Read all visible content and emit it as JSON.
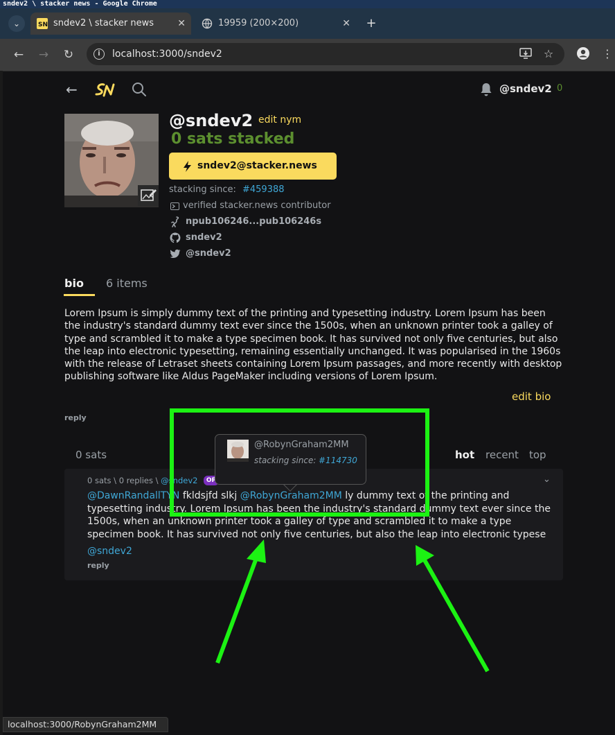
{
  "os": {
    "window_title": "sndev2 \\ stacker news - Google Chrome"
  },
  "browser": {
    "tabs": [
      {
        "label": "sndev2 \\ stacker news",
        "active": true
      },
      {
        "label": "19959 (200×200)",
        "active": false
      }
    ],
    "url": "localhost:3000/sndev2",
    "status_url": "localhost:3000/RobynGraham2MM"
  },
  "header": {
    "me_name": "@sndev2",
    "me_sats": "0"
  },
  "profile": {
    "nym": "@sndev2",
    "edit_nym": "edit nym",
    "sats_stacked": "0 sats stacked",
    "ln_address": "sndev2@stacker.news",
    "stacking_since_label": "stacking since:",
    "stacking_since_link": "#459388",
    "verified": "verified stacker.news contributor",
    "nostr": "npub106246...pub106246s",
    "github": "sndev2",
    "twitter": "@sndev2"
  },
  "tabs": {
    "bio": "bio",
    "items": "6 items"
  },
  "bio": {
    "text": "Lorem Ipsum is simply dummy text of the printing and typesetting industry. Lorem Ipsum has been the industry's standard dummy text ever since the 1500s, when an unknown printer took a galley of type and scrambled it to make a type specimen book. It has survived not only five centuries, but also the leap into electronic typesetting, remaining essentially unchanged. It was popularised in the 1960s with the release of Letraset sheets containing Lorem Ipsum passages, and more recently with desktop publishing software like Aldus PageMaker including versions of Lorem Ipsum.",
    "edit": "edit bio",
    "reply": "reply"
  },
  "comments_header": {
    "sats": "0 sats",
    "sort": [
      "hot",
      "recent",
      "top"
    ]
  },
  "comment": {
    "meta": "0 sats \\ 0 replies \\ ",
    "author": "@sndev2",
    "op_badge": "OP",
    "collapse": "⌄",
    "mention1": "@DawnRandallTYN",
    "text1": " fkldsjfd slkj ",
    "mention2": "@RobynGraham2MM",
    "text2": " ly dummy text of the printing and typesetting industry. Lorem Ipsum has been the industry's standard dummy text ever since the 1500s, when an unknown printer took a galley of type and scrambled it to make a type specimen book. It has survived not only five centuries, but also the leap into electronic typese",
    "signature": "@sndev2",
    "reply": "reply"
  },
  "popover": {
    "name": "@RobynGraham2MM",
    "stacking_since_label": "stacking since:",
    "stacking_since_link": "#114730"
  },
  "colors": {
    "accent_yellow": "#fada5e",
    "link_blue": "#3fa7d6",
    "sats_green": "#5c8f2f",
    "annotation_green": "#1cf213",
    "op_purple": "#7b2fbe"
  }
}
